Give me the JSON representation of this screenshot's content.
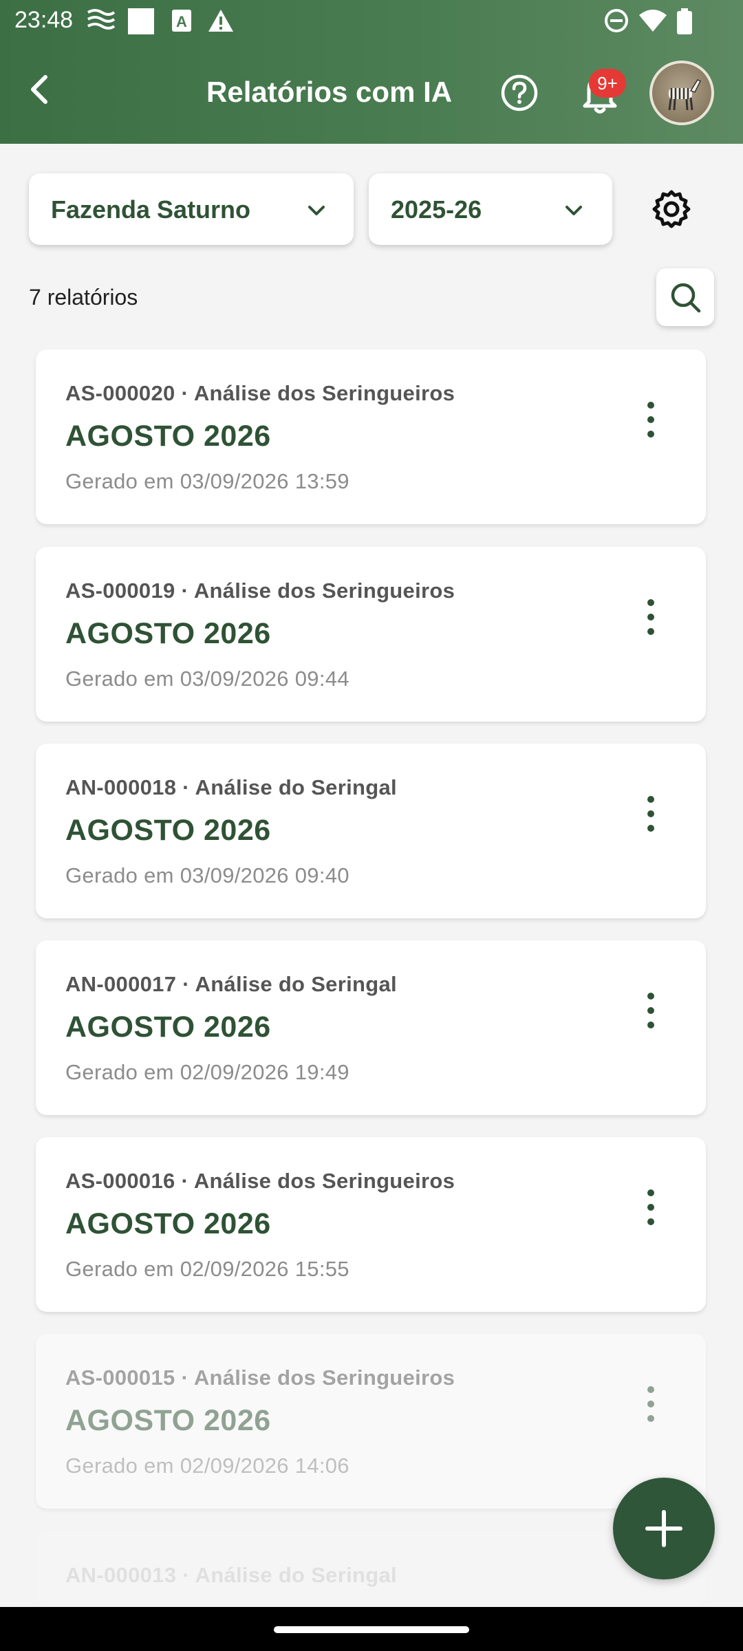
{
  "status_bar": {
    "time": "23:48",
    "icons": [
      "wifi-calling-icon",
      "square-icon",
      "font-a-icon",
      "warning-icon",
      "do-not-disturb-icon",
      "wifi-icon",
      "battery-icon"
    ]
  },
  "app_bar": {
    "title": "Relatórios com IA",
    "notification_badge": "9+",
    "icons": [
      "back-arrow-icon",
      "help-icon",
      "bell-icon",
      "avatar"
    ]
  },
  "filters": {
    "farm": "Fazenda Saturno",
    "season": "2025-26"
  },
  "report_count": "7 relatórios",
  "reports": [
    {
      "code": "AS-000020 · Análise dos Seringueiros",
      "month": "AGOSTO 2026",
      "generated": "Gerado em 03/09/2026 13:59"
    },
    {
      "code": "AS-000019 · Análise dos Seringueiros",
      "month": "AGOSTO 2026",
      "generated": "Gerado em 03/09/2026 09:44"
    },
    {
      "code": "AN-000018 · Análise do Seringal",
      "month": "AGOSTO 2026",
      "generated": "Gerado em 03/09/2026 09:40"
    },
    {
      "code": "AN-000017 · Análise do Seringal",
      "month": "AGOSTO 2026",
      "generated": "Gerado em 02/09/2026 19:49"
    },
    {
      "code": "AS-000016 · Análise dos Seringueiros",
      "month": "AGOSTO 2026",
      "generated": "Gerado em 02/09/2026 15:55"
    },
    {
      "code": "AS-000015 · Análise dos Seringueiros",
      "month": "AGOSTO 2026",
      "generated": "Gerado em 02/09/2026 14:06"
    },
    {
      "code": "AN-000013 · Análise do Seringal",
      "month": "",
      "generated": ""
    }
  ],
  "colors": {
    "primary": "#2f5235",
    "app_bar": "#4a7c51",
    "badge": "#e53935",
    "fab": "#2f5639"
  }
}
